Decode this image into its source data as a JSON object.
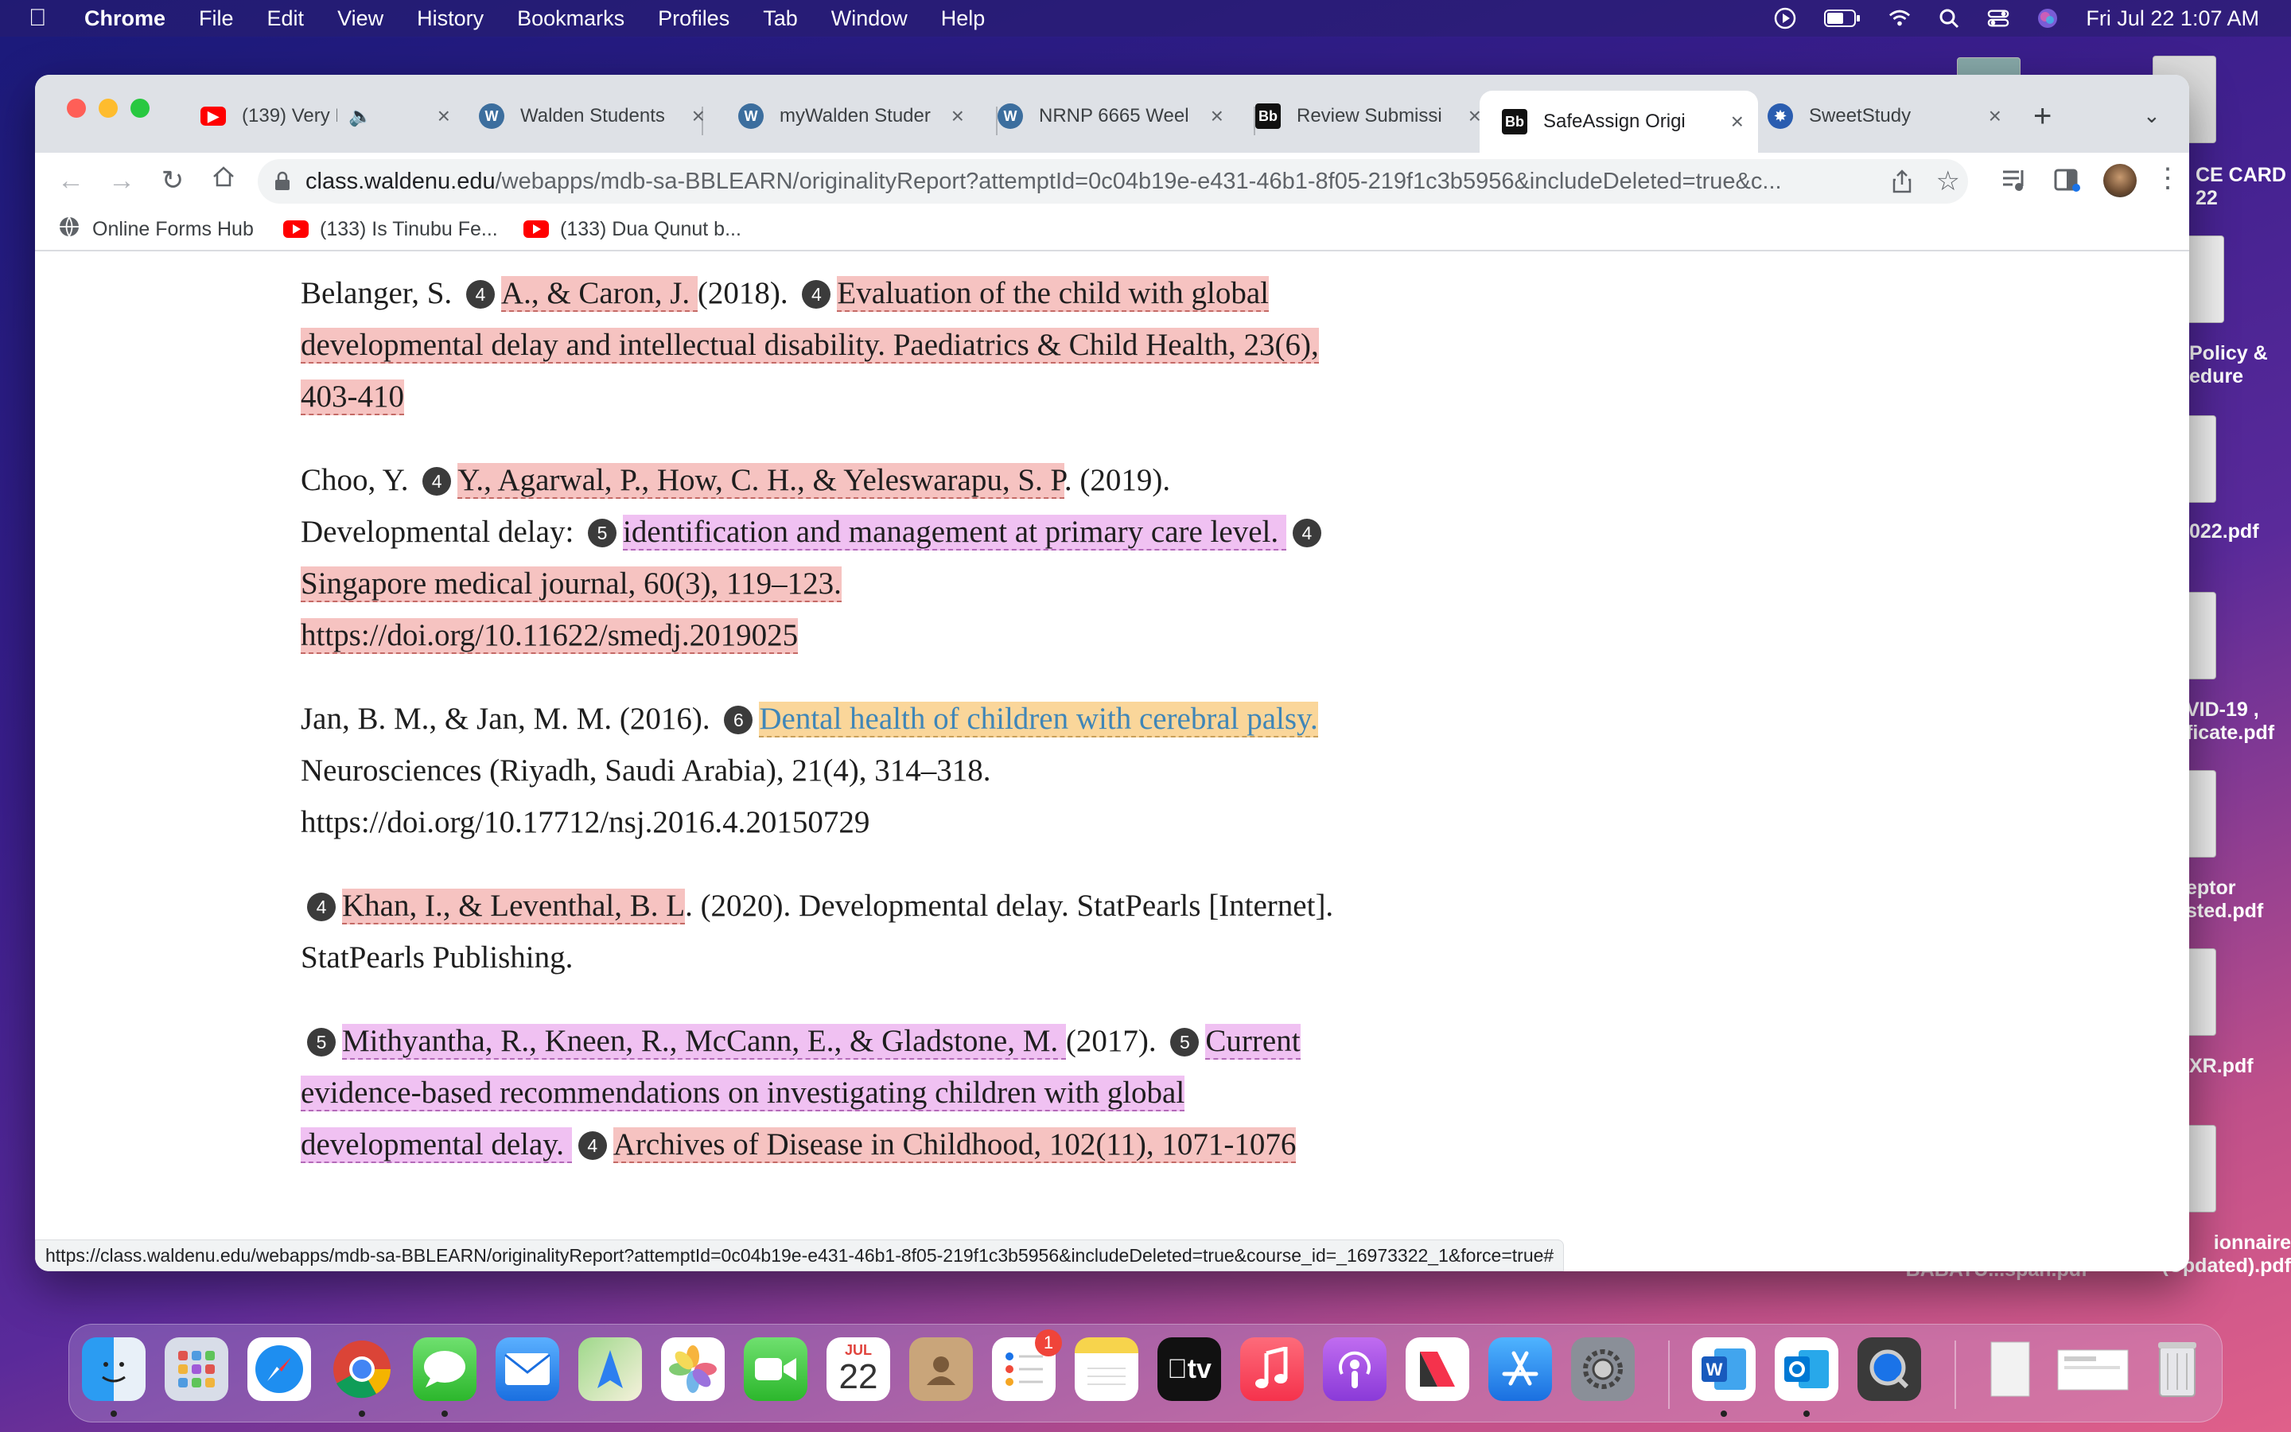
{
  "menubar": {
    "app_name": "Chrome",
    "menus": [
      "File",
      "Edit",
      "View",
      "History",
      "Bookmarks",
      "Profiles",
      "Tab",
      "Window",
      "Help"
    ],
    "clock": "Fri Jul 22  1:07 AM"
  },
  "desktop": {
    "items": [
      "CE CARD\n22",
      "Policy &\nedure",
      "022.pdf",
      "VID-19 ,\nficate.pdf",
      "eptor\nsted.pdf",
      "XR.pdf",
      "ionnaire\n(Updated).pdf",
      "BABATU...span.pdf"
    ]
  },
  "tabs": [
    {
      "title": "(139) Very Po",
      "icon": "youtube-icon"
    },
    {
      "title": "Walden Students",
      "icon": "walden-w-icon"
    },
    {
      "title": "myWalden Studer",
      "icon": "walden-w-icon"
    },
    {
      "title": "NRNP 6665 Weel",
      "icon": "walden-w-icon"
    },
    {
      "title": "Review Submissi",
      "icon": "blackboard-icon"
    },
    {
      "title": "SafeAssign Origi",
      "icon": "blackboard-icon",
      "active": true
    },
    {
      "title": "SweetStudy",
      "icon": "sweetstudy-icon"
    }
  ],
  "address": {
    "host": "class.waldenu.edu",
    "path": "/webapps/mdb-sa-BBLEARN/originalityReport?attemptId=0c04b19e-e431-46b1-8f05-219f1c3b5956&includeDeleted=true&c..."
  },
  "bookmarks": [
    "Online Forms Hub",
    "(133) Is Tinubu Fe...",
    "(133) Dua Qunut b..."
  ],
  "references": [
    {
      "segments": [
        {
          "text": "Belanger, S. "
        },
        {
          "badge": "4"
        },
        {
          "text": "A., & Caron, J. ",
          "hl": "4"
        },
        {
          "text": "(2018). "
        },
        {
          "badge": "4"
        },
        {
          "text": "Evaluation of the child with global developmental delay and intellectual disability.  Paediatrics & Child Health, 23(6), 403-410",
          "hl": "4"
        }
      ]
    },
    {
      "segments": [
        {
          "text": "Choo, Y. "
        },
        {
          "badge": "4"
        },
        {
          "text": "Y., Agarwal, P., How, C. H., & Yeleswarapu, S. P",
          "hl": "4"
        },
        {
          "text": ". (2019). Developmental delay: "
        },
        {
          "badge": "5"
        },
        {
          "text": "identification and management at primary care level. ",
          "hl": "5"
        },
        {
          "badge": "4"
        },
        {
          "text": "Singapore medical journal, 60(3), 119–123.  https://doi.org/10.11622/smedj.2019025",
          "hl": "4"
        }
      ]
    },
    {
      "segments": [
        {
          "text": "Jan, B. M., & Jan, M. M. (2016). "
        },
        {
          "badge": "6"
        },
        {
          "text": "Dental health of children with cerebral palsy. ",
          "hl": "6"
        },
        {
          "text": "Neurosciences (Riyadh, Saudi Arabia), 21(4), 314–318. https://doi.org/10.17712/nsj.2016.4.20150729"
        }
      ]
    },
    {
      "segments": [
        {
          "badge": "4"
        },
        {
          "text": "Khan, I., & Leventhal, B. L",
          "hl": "4"
        },
        {
          "text": ". (2020). Developmental delay. StatPearls [Internet]. StatPearls Publishing."
        }
      ]
    },
    {
      "segments": [
        {
          "badge": "5"
        },
        {
          "text": "Mithyantha, R., Kneen, R., McCann, E., & Gladstone, M. ",
          "hl": "5"
        },
        {
          "text": "(2017). "
        },
        {
          "badge": "5"
        },
        {
          "text": "Current evidence-based recommendations on investigating children with global developmental delay. ",
          "hl": "5"
        },
        {
          "badge": "4"
        },
        {
          "text": "Archives of Disease in Childhood, 102(11), 1071-1076",
          "hl": "4"
        }
      ]
    }
  ],
  "status_url": "https://class.waldenu.edu/webapps/mdb-sa-BBLEARN/originalityReport?attemptId=0c04b19e-e431-46b1-8f05-219f1c3b5956&includeDeleted=true&course_id=_16973322_1&force=true#",
  "dock": {
    "calendar_month": "JUL",
    "calendar_day": "22",
    "reminders_badge": "1",
    "tv_label": "tv"
  },
  "colors": {
    "match_4": "#f6c3c1",
    "match_5": "#f0c1f2",
    "match_6": "#fad69a"
  }
}
